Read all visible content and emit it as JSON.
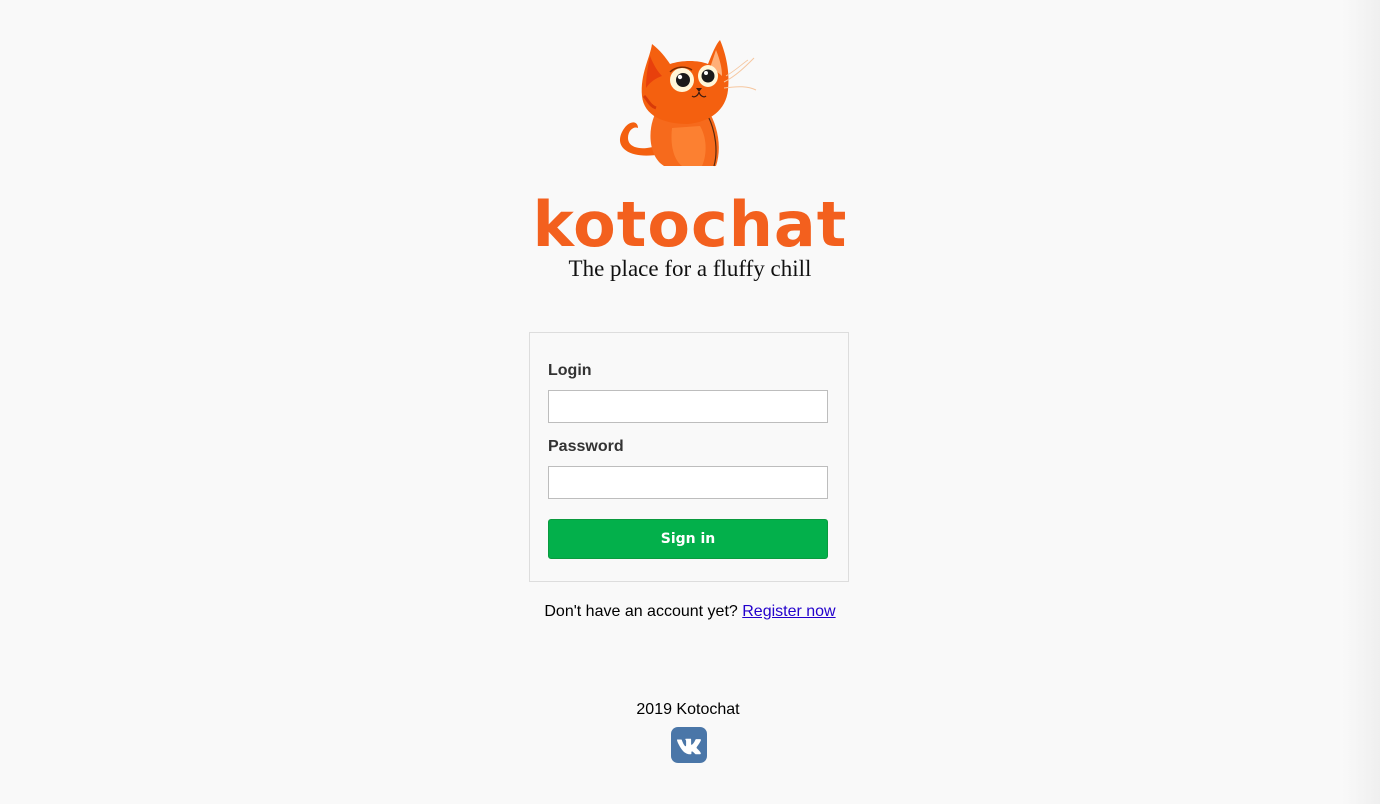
{
  "brand": {
    "name": "kotochat",
    "tagline": "The place for a fluffy chill",
    "accent_color": "#f3601e",
    "logo_icon": "orange-cat-icon"
  },
  "login_form": {
    "login_label": "Login",
    "login_value": "",
    "password_label": "Password",
    "password_value": "",
    "submit_label": "Sign in",
    "submit_color": "#03b04b"
  },
  "register": {
    "prompt": "Don't have an account yet?",
    "link_label": "Register now",
    "link_color": "#2200cc"
  },
  "footer": {
    "copyright": "2019 Kotochat",
    "social_icon": "vk-icon",
    "social_color": "#4a76a8"
  }
}
